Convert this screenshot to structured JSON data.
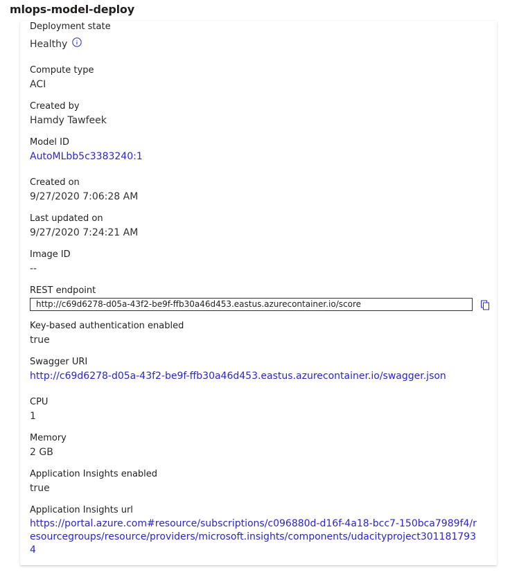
{
  "title": "mlops-model-deploy",
  "colors": {
    "link": "#2b26c8",
    "text": "#323130",
    "border": "#323130"
  },
  "fields": {
    "deployment_state": {
      "label": "Deployment state",
      "value": "Healthy",
      "icon": "info-icon"
    },
    "compute_type": {
      "label": "Compute type",
      "value": "ACI"
    },
    "created_by": {
      "label": "Created by",
      "value": "Hamdy Tawfeek"
    },
    "model_id": {
      "label": "Model ID",
      "value": "AutoMLbb5c3383240:1"
    },
    "created_on": {
      "label": "Created on",
      "value": "9/27/2020 7:06:28 AM"
    },
    "last_updated_on": {
      "label": "Last updated on",
      "value": "9/27/2020 7:24:21 AM"
    },
    "image_id": {
      "label": "Image ID",
      "value": "--"
    },
    "rest_endpoint": {
      "label": "REST endpoint",
      "value": "http://c69d6278-d05a-43f2-be9f-ffb30a46d453.eastus.azurecontainer.io/score",
      "icon": "copy-icon"
    },
    "key_auth": {
      "label": "Key-based authentication enabled",
      "value": "true"
    },
    "swagger_uri": {
      "label": "Swagger URI",
      "value": "http://c69d6278-d05a-43f2-be9f-ffb30a46d453.eastus.azurecontainer.io/swagger.json"
    },
    "cpu": {
      "label": "CPU",
      "value": "1"
    },
    "memory": {
      "label": "Memory",
      "value": "2 GB"
    },
    "app_insights_enabled": {
      "label": "Application Insights enabled",
      "value": "true"
    },
    "app_insights_url": {
      "label": "Application Insights url",
      "value": "https://portal.azure.com#resource/subscriptions/c096880d-d16f-4a18-bcc7-150bca7989f4/resourcegroups/resource/providers/microsoft.insights/components/udacityproject3011817934"
    }
  }
}
